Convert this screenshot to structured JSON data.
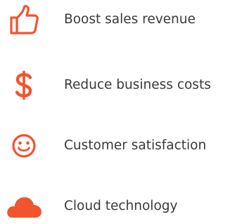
{
  "colors": {
    "accent": "#f2542d",
    "text": "#3a3a3a",
    "background": "#ffffff"
  },
  "features": [
    {
      "icon": "thumbs-up-icon",
      "label": "Boost sales revenue"
    },
    {
      "icon": "dollar-icon",
      "label": "Reduce business costs"
    },
    {
      "icon": "smiley-icon",
      "label": "Customer satisfaction"
    },
    {
      "icon": "cloud-icon",
      "label": "Cloud technology"
    }
  ]
}
